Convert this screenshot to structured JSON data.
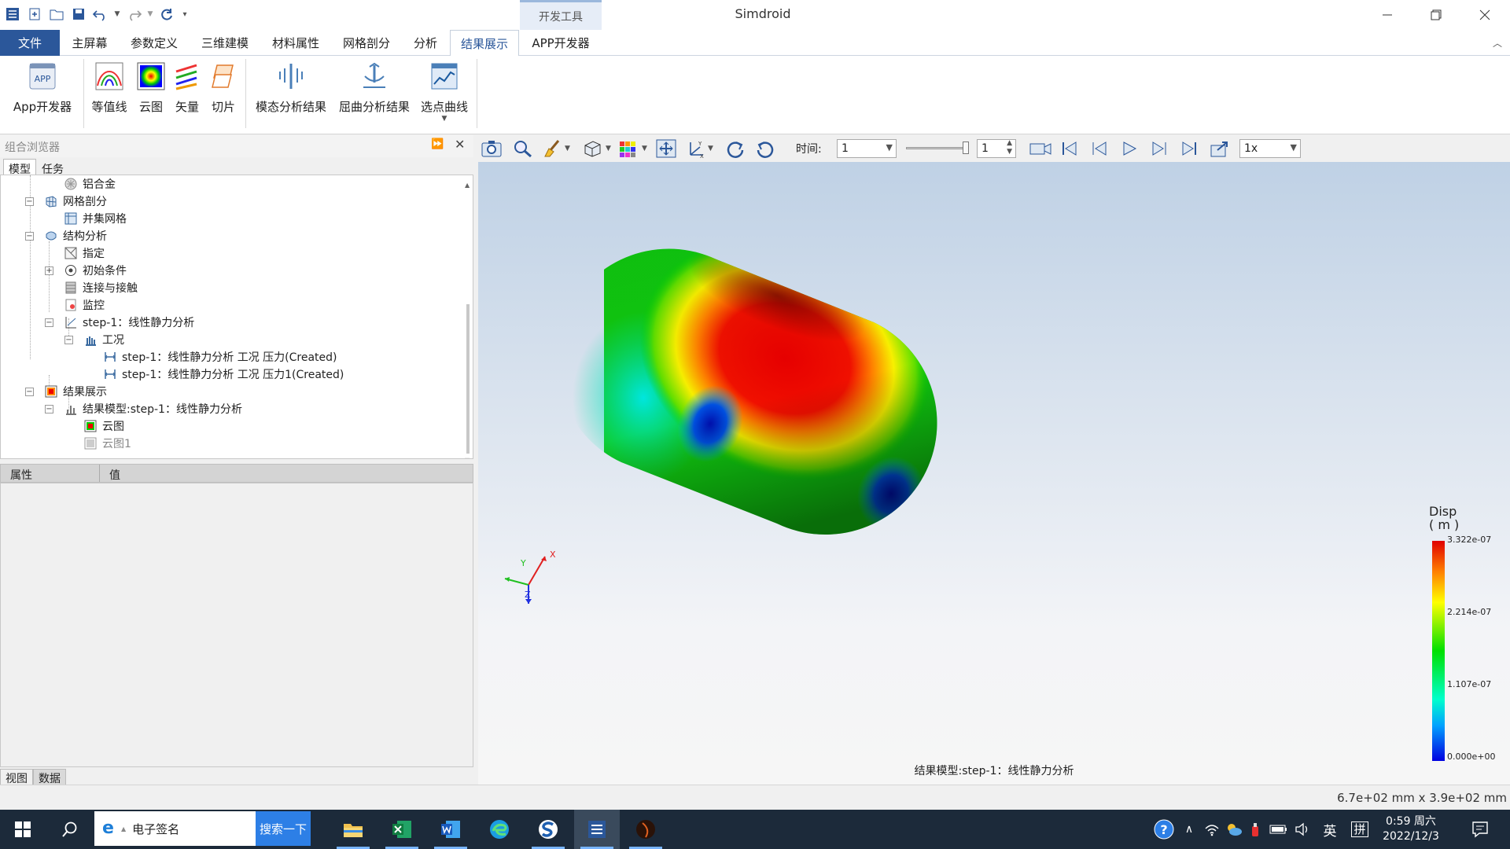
{
  "app": {
    "title": "Simdroid",
    "context_tab": "开发工具"
  },
  "ribbon_tabs": [
    "文件",
    "主屏幕",
    "参数定义",
    "三维建模",
    "材料属性",
    "网格剖分",
    "分析",
    "结果展示",
    "APP开发器"
  ],
  "active_tab": "结果展示",
  "ribbon_buttons": {
    "app_dev": "App开发器",
    "contour": "等值线",
    "cloud": "云图",
    "vector": "矢量",
    "slice": "切片",
    "modal": "模态分析结果",
    "buckling": "屈曲分析结果",
    "curve": "选点曲线"
  },
  "browser": {
    "title": "组合浏览器",
    "tabs": [
      "模型",
      "任务"
    ]
  },
  "tree": [
    {
      "label": "铝合金",
      "icon": "material-icon"
    },
    {
      "label": "网格剖分",
      "icon": "mesh-icon",
      "expand": "−"
    },
    {
      "label": "并集网格",
      "icon": "mesh-union-icon"
    },
    {
      "label": "结构分析",
      "icon": "analysis-icon",
      "expand": "−"
    },
    {
      "label": "指定",
      "icon": "assign-icon"
    },
    {
      "label": "初始条件",
      "icon": "initial-condition-icon",
      "expand": "+"
    },
    {
      "label": "连接与接触",
      "icon": "contact-icon"
    },
    {
      "label": "监控",
      "icon": "monitor-icon"
    },
    {
      "label": "step-1：线性静力分析",
      "icon": "step-icon",
      "expand": "−"
    },
    {
      "label": "工况",
      "icon": "load-case-icon",
      "expand": "−"
    },
    {
      "label": "step-1：线性静力分析 工况 压力(Created)",
      "icon": "pressure-icon"
    },
    {
      "label": "step-1：线性静力分析 工况 压力1(Created)",
      "icon": "pressure-icon"
    },
    {
      "label": "结果展示",
      "icon": "results-icon",
      "expand": "−"
    },
    {
      "label": "结果模型:step-1：线性静力分析",
      "icon": "result-model-icon",
      "expand": "−"
    },
    {
      "label": "云图",
      "icon": "cloud-map-icon"
    },
    {
      "label": "云图1",
      "icon": "cloud-map-icon"
    }
  ],
  "properties": {
    "col_property": "属性",
    "col_value": "值"
  },
  "bottom_tabs": [
    "视图",
    "数据"
  ],
  "toolbar": {
    "time_label": "时间:",
    "time_value": "1",
    "step_value": "1",
    "speed_value": "1x"
  },
  "viewport": {
    "caption": "结果模型:step-1：线性静力分析",
    "axis_x": "X",
    "axis_y": "Y",
    "axis_z": "Z"
  },
  "legend": {
    "title": "Disp",
    "unit": "( m )",
    "labels": [
      "3.322e-07",
      "2.214e-07",
      "1.107e-07",
      "0.000e+00"
    ]
  },
  "status": {
    "dimensions": "6.7e+02 mm x 3.9e+02 mm"
  },
  "taskbar": {
    "search_text": "电子签名",
    "search_button": "搜索一下",
    "ime_lang": "英",
    "ime_mode": "拼",
    "time": "0:59 周六",
    "date": "2022/12/3"
  },
  "colors": {
    "accent": "#2b579a",
    "taskbar": "#1c2a3a",
    "search_button": "#2d7fe6"
  }
}
